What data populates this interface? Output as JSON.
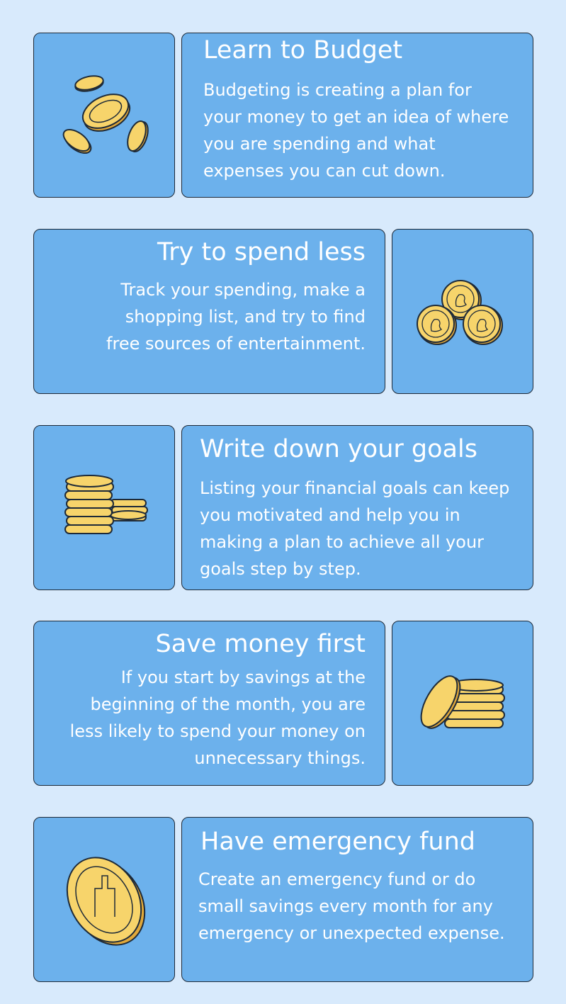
{
  "sections": [
    {
      "title": "Learn to Budget",
      "body": "Budgeting is creating a plan for your money to get an idea of where you are spending and what expenses you can cut down.",
      "icon": "scattered-coins-icon"
    },
    {
      "title": "Try to spend less",
      "body": "Track your spending, make a shopping list, and try to find free sources of entertainment.",
      "icon": "three-portrait-coins-icon"
    },
    {
      "title": "Write down your goals",
      "body": "Listing your financial goals can keep you motivated and help you in making a plan to achieve all your goals step by step.",
      "icon": "coin-stacks-icon"
    },
    {
      "title": "Save money first",
      "body": "If you start by savings at the beginning of the month, you are less likely to spend your money on unnecessary things.",
      "icon": "coin-pile-icon"
    },
    {
      "title": "Have emergency fund",
      "body": "Create an emergency fund or do small savings every month for any emergency or unexpected expense.",
      "icon": "large-coin-icon"
    }
  ],
  "colors": {
    "background": "#d8eafc",
    "card": "#6cb1ec",
    "border": "#1e2a38",
    "text": "#ffffff",
    "coin": "#f7d46b",
    "coin_shadow": "#e0a83a"
  }
}
